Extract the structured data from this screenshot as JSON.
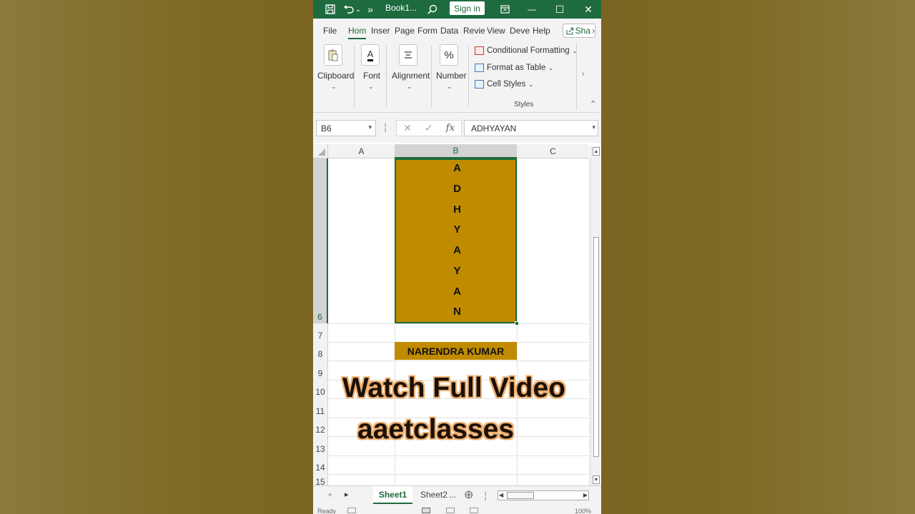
{
  "titlebar": {
    "save_icon": "save-icon",
    "undo_icon": "undo-icon",
    "undo_dd": "⌄",
    "more": "»",
    "title": "Book1...",
    "search_icon": "search-icon",
    "signin": "Sign in",
    "ribbon_display_icon": "ribbon-display-icon",
    "minimize": "—",
    "maximize": "☐",
    "close": "✕"
  },
  "tabs": [
    "File",
    "Hom",
    "Inser",
    "Page",
    "Form",
    "Data",
    "Revie",
    "View",
    "Deve",
    "Help"
  ],
  "share_label": "Sha",
  "share_chevron": "›",
  "ribbon": {
    "clipboard": "Clipboard",
    "font": "Font",
    "alignment": "Alignment",
    "number": "Number",
    "number_glyph": "%",
    "font_glyph": "A",
    "chev": "⌄",
    "conditional_formatting": "Conditional Formatting",
    "format_as_table": "Format as Table",
    "cell_styles": "Cell Styles",
    "styles": "Styles",
    "scroll_right": "›",
    "collapse": "⌃"
  },
  "formula_bar": {
    "name_box": "B6",
    "dd": "▾",
    "cancel": "✕",
    "enter": "✓",
    "fx": "fx",
    "content": "ADHYAYAN"
  },
  "grid": {
    "columns": [
      "A",
      "B",
      "C"
    ],
    "rows": [
      "6",
      "7",
      "8",
      "9",
      "10",
      "11",
      "12",
      "13",
      "14",
      "15"
    ],
    "b6_letters": [
      "A",
      "D",
      "H",
      "Y",
      "A",
      "Y",
      "A",
      "N"
    ],
    "b8": "NARENDRA KUMAR"
  },
  "overlay": {
    "line1": "Watch Full Video",
    "line2": "aaetclasses"
  },
  "scroll": {
    "up": "▲",
    "down": "▼",
    "left": "◀",
    "right": "▶"
  },
  "sheets": {
    "prev": "◂",
    "next": "▸",
    "active": "Sheet1",
    "other": "Sheet2",
    "ellipsis": "...",
    "add": "⊕"
  },
  "status": {
    "ready": "Ready",
    "zoom": "100%"
  },
  "colors": {
    "excel_green": "#1e6b3f",
    "cell_fill": "#c08b00"
  }
}
